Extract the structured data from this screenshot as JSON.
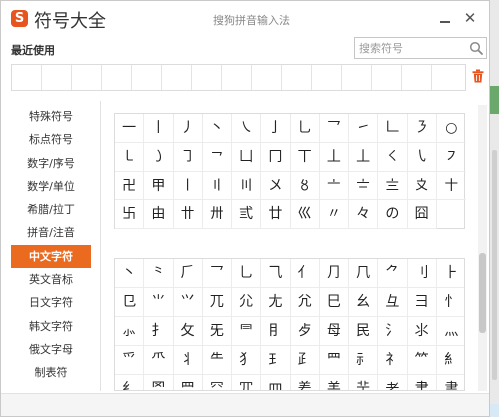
{
  "window": {
    "app_title": "符号大全",
    "subtitle": "搜狗拼音输入法",
    "logo_letter": "S",
    "minimize_icon": "minimize-icon",
    "close_glyph": "✕"
  },
  "recent": {
    "label": "最近使用",
    "slots": 15
  },
  "search": {
    "placeholder": "搜索符号",
    "value": ""
  },
  "nav": {
    "items": [
      {
        "label": "特殊符号",
        "active": false
      },
      {
        "label": "标点符号",
        "active": false
      },
      {
        "label": "数字/序号",
        "active": false
      },
      {
        "label": "数学/单位",
        "active": false
      },
      {
        "label": "希腊/拉丁",
        "active": false
      },
      {
        "label": "拼音/注音",
        "active": false
      },
      {
        "label": "中文字符",
        "active": true
      },
      {
        "label": "英文音标",
        "active": false
      },
      {
        "label": "日文字符",
        "active": false
      },
      {
        "label": "韩文字符",
        "active": false
      },
      {
        "label": "俄文字母",
        "active": false
      },
      {
        "label": "制表符",
        "active": false
      }
    ]
  },
  "colors": {
    "accent": "#ea6a1f",
    "logo": "#e8541e",
    "trash": "#e8541e"
  },
  "grid_top": [
    "一",
    "丨",
    "丿",
    "丶",
    "㇏",
    "亅",
    "乚",
    "乛",
    "㇀",
    "𠃊",
    "㇋",
    "○",
    "㇄",
    "㇁",
    "㇆",
    "㇖",
    "凵",
    "冂",
    "丅",
    "丄",
    "丄",
    "㇛",
    "㇂",
    "㇇",
    "卍",
    "甲",
    "〡",
    "〢",
    "〣",
    "〤",
    "〥",
    "〦",
    "〧",
    "〨",
    "〩",
    "〸",
    "卐",
    "由",
    "〹",
    "〺",
    "弎",
    "廿",
    "巛",
    "〃",
    "々",
    "の",
    "囧"
  ],
  "grid_bottom": [
    "丶",
    "⺀",
    "⺁",
    "⺂",
    "⺃",
    "⺄",
    "⺅",
    "⺆",
    "⺇",
    "⺈",
    "⺉",
    "⺊",
    "⺋",
    "⺌",
    "⺍",
    "⺎",
    "⺏",
    "⺐",
    "⺑",
    "⺒",
    "⺓",
    "⺔",
    "⺕",
    "⺖",
    "⺗",
    "⺘",
    "⺙",
    "⺛",
    "⺜",
    "⺝",
    "⺞",
    "⺟",
    "⺠",
    "⺡",
    "⺢",
    "⺣",
    "⺤",
    "⺥",
    "⺦",
    "⺧",
    "⺨",
    "⺩",
    "⺪",
    "⺫",
    "⺬",
    "⺭",
    "⺮",
    "⺯",
    "⺰",
    "⺱",
    "⺲",
    "⺳",
    "⺴",
    "⺵",
    "⺶",
    "⺷",
    "⺸",
    "⺹",
    "⺺",
    "⺻"
  ]
}
